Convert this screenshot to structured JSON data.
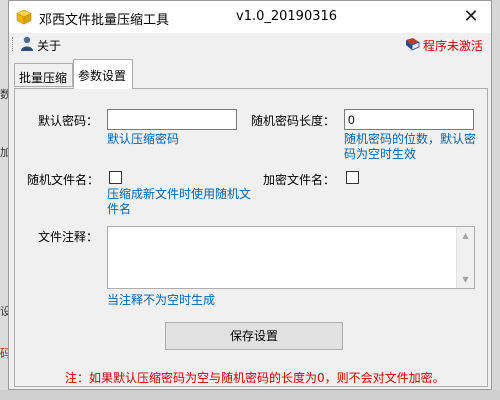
{
  "window": {
    "title": "邓西文件批量压缩工具",
    "version": "v1.0_20190316",
    "close_glyph": "✕"
  },
  "menubar": {
    "about_label": "关于",
    "activation_status": "程序未激活"
  },
  "tabs": [
    {
      "label": "批量压缩",
      "active": false
    },
    {
      "label": "参数设置",
      "active": true
    }
  ],
  "form": {
    "default_password": {
      "label": "默认密码：",
      "value": "",
      "hint": "默认压缩密码"
    },
    "random_password_length": {
      "label": "随机密码长度：",
      "value": "0",
      "hint": "随机密码的位数，默认密码为空时生效"
    },
    "random_filename": {
      "label": "随机文件名：",
      "checked": false,
      "hint": "压缩成新文件时使用随机文件名"
    },
    "encrypt_filename": {
      "label": "加密文件名：",
      "checked": false
    },
    "file_comment": {
      "label": "文件注释：",
      "value": "",
      "hint": "当注释不为空时生成"
    },
    "save_button": "保存设置",
    "note": "注：如果默认压缩密码为空与随机密码的长度为0，则不会对文件加密。"
  },
  "background_fragments": [
    "数",
    "加",
    "设",
    "码"
  ],
  "colors": {
    "hint_blue": "#0063b1",
    "warning_red": "#d00000",
    "active_tab_bg": "#ffffff",
    "panel_bg": "#f0f0f0"
  },
  "icons": [
    "app-package-icon",
    "user-icon",
    "book-icon",
    "close-icon",
    "scroll-up-arrow-icon",
    "scroll-down-arrow-icon"
  ]
}
